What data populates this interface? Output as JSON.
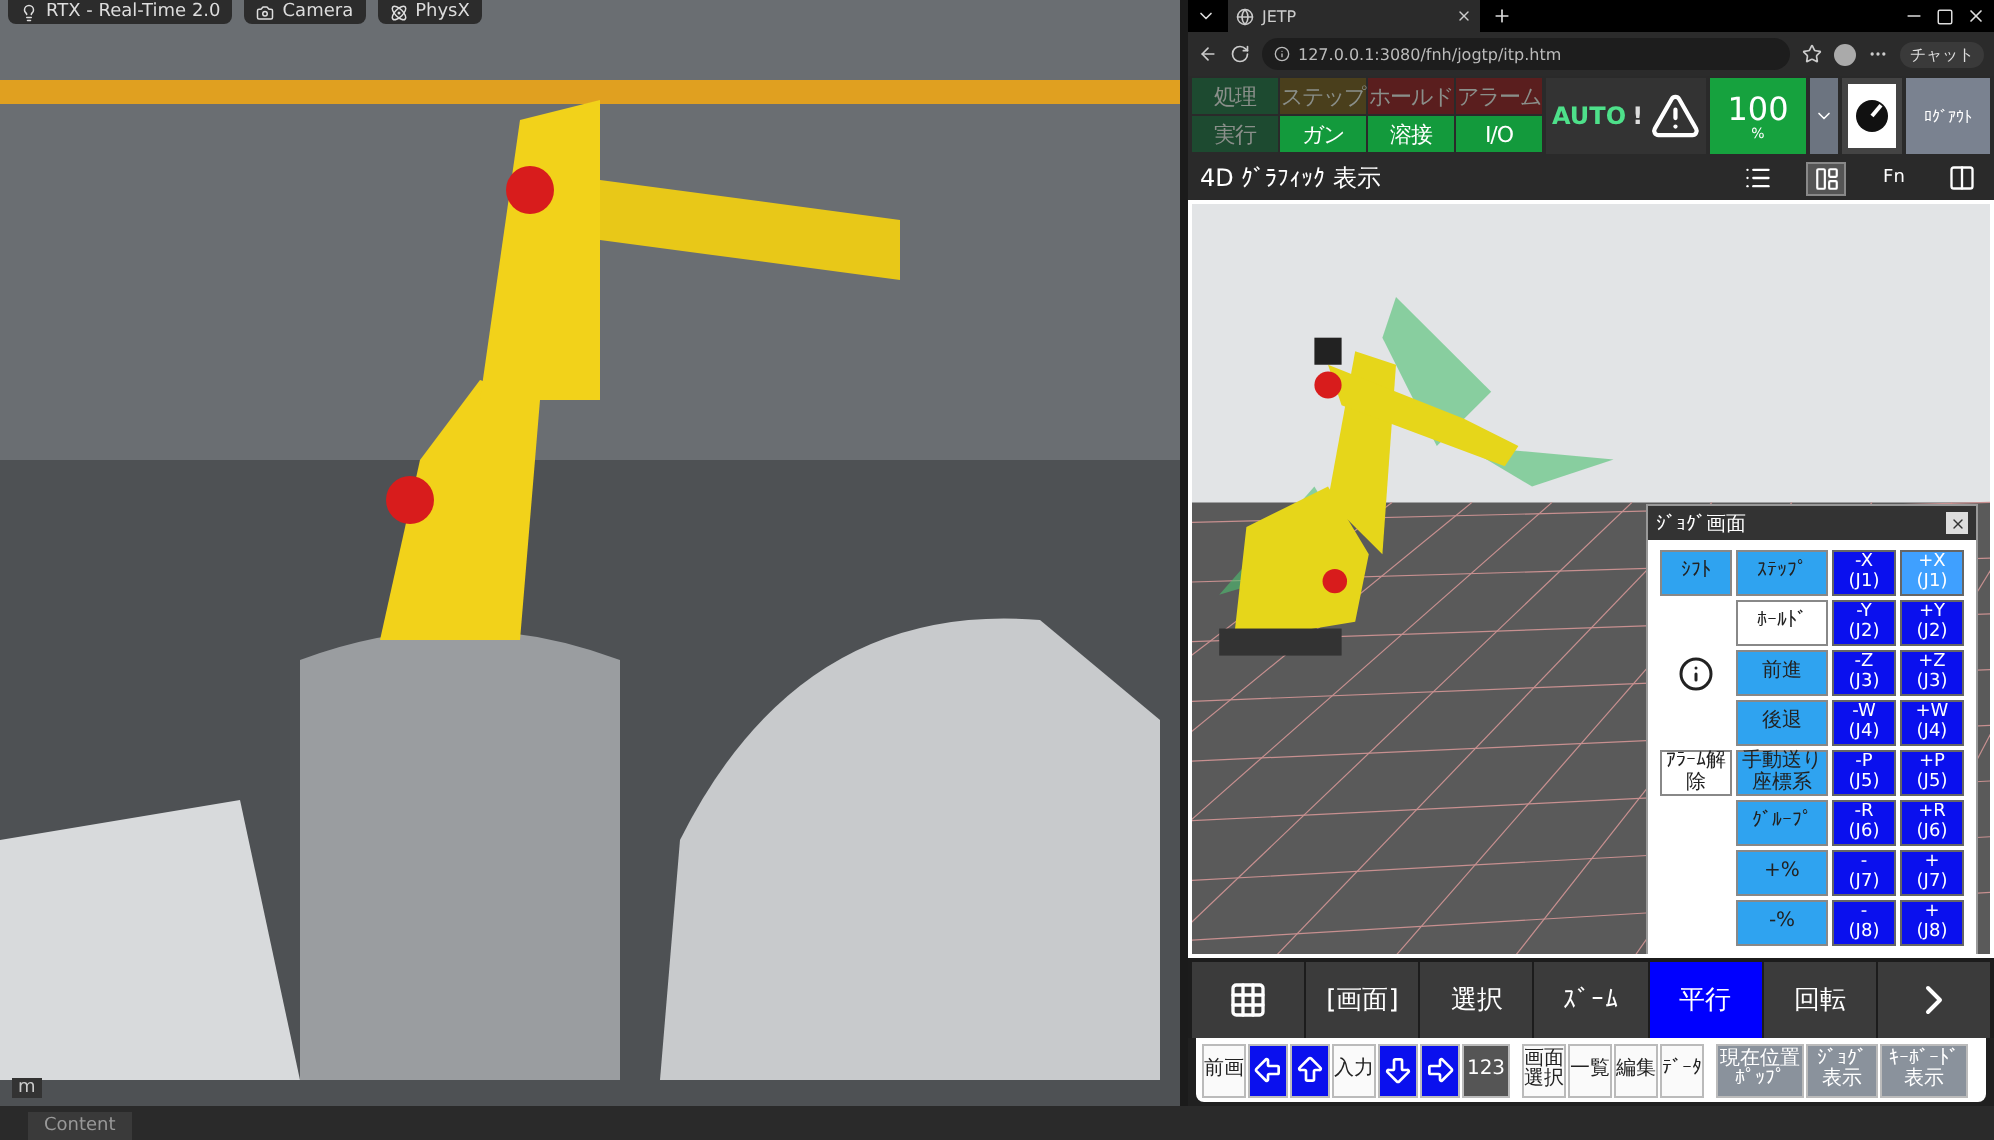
{
  "scene": {
    "toolbar": [
      {
        "kind": "render",
        "label": "RTX - Real-Time 2.0"
      },
      {
        "kind": "camera",
        "label": "Camera"
      },
      {
        "kind": "physics",
        "label": "PhysX"
      }
    ],
    "unit": "m"
  },
  "bottom_tabs": [
    {
      "label": "Content",
      "selected": true
    }
  ],
  "browser": {
    "tab_title": "JETP",
    "url": "127.0.0.1:3080/fnh/jogtp/itp.htm",
    "chat_label": "チャット"
  },
  "status": [
    {
      "label": "処理",
      "on": false,
      "color": "#1d4a30"
    },
    {
      "label": "ステップ",
      "on": false,
      "color": "#4a3f1c"
    },
    {
      "label": "ホールド",
      "on": false,
      "color": "#5a1e1e"
    },
    {
      "label": "アラーム",
      "on": false,
      "color": "#5a1e1e"
    },
    {
      "label": "実行",
      "on": false,
      "color": "#1d4a30"
    },
    {
      "label": "ガン",
      "on": true,
      "color": "#139a3c"
    },
    {
      "label": "溶接",
      "on": true,
      "color": "#139a3c"
    },
    {
      "label": "I/O",
      "on": true,
      "color": "#139a3c"
    }
  ],
  "mode": "AUTO",
  "alert_mark": "!",
  "override": {
    "value": "100",
    "unit": "%"
  },
  "logout": "ﾛｸﾞｱｳﾄ",
  "screen_title": "4D ｸﾞﾗﾌｨｯｸ 表示",
  "view_tools": [
    {
      "kind": "list",
      "selected": false
    },
    {
      "kind": "split",
      "selected": true
    },
    {
      "kind": "fn",
      "label": "Fn",
      "selected": false
    },
    {
      "kind": "layout",
      "selected": false
    }
  ],
  "jog_panel": {
    "title": "ｼﾞｮｸﾞ画面",
    "left": [
      {
        "kind": "key",
        "label": "ｼﾌﾄ",
        "lit": true
      },
      {
        "kind": "info"
      },
      {
        "kind": "key",
        "label": "ｱﾗｰﾑ解除",
        "lit": false
      }
    ],
    "middle": [
      {
        "label": "ｽﾃｯﾌﾟ",
        "lit": true
      },
      {
        "label": "ﾎｰﾙﾄﾞ",
        "lit": false
      },
      {
        "label": "前進",
        "lit": true
      },
      {
        "label": "後退",
        "lit": true
      },
      {
        "label": "手動送り座標系",
        "lit": true
      },
      {
        "label": "ｸﾞﾙｰﾌﾟ",
        "lit": true
      },
      {
        "label": "+%",
        "lit": true
      },
      {
        "label": "-%",
        "lit": true
      }
    ],
    "axes": [
      {
        "minus": {
          "label": "-X",
          "axis": "(J1)",
          "highlighted": false
        },
        "plus": {
          "label": "+X",
          "axis": "(J1)",
          "highlighted": true
        }
      },
      {
        "minus": {
          "label": "-Y",
          "axis": "(J2)",
          "highlighted": false
        },
        "plus": {
          "label": "+Y",
          "axis": "(J2)",
          "highlighted": false
        }
      },
      {
        "minus": {
          "label": "-Z",
          "axis": "(J3)",
          "highlighted": false
        },
        "plus": {
          "label": "+Z",
          "axis": "(J3)",
          "highlighted": false
        }
      },
      {
        "minus": {
          "label": "-W",
          "axis": "(J4)",
          "highlighted": false
        },
        "plus": {
          "label": "+W",
          "axis": "(J4)",
          "highlighted": false
        }
      },
      {
        "minus": {
          "label": "-P",
          "axis": "(J5)",
          "highlighted": false
        },
        "plus": {
          "label": "+P",
          "axis": "(J5)",
          "highlighted": false
        }
      },
      {
        "minus": {
          "label": "-R",
          "axis": "(J6)",
          "highlighted": false
        },
        "plus": {
          "label": "+R",
          "axis": "(J6)",
          "highlighted": false
        }
      },
      {
        "minus": {
          "label": "-",
          "axis": "(J7)",
          "highlighted": false
        },
        "plus": {
          "label": "+",
          "axis": "(J7)",
          "highlighted": false
        }
      },
      {
        "minus": {
          "label": "-",
          "axis": "(J8)",
          "highlighted": false
        },
        "plus": {
          "label": "+",
          "axis": "(J8)",
          "highlighted": false
        }
      }
    ]
  },
  "menu": [
    {
      "kind": "grid",
      "selected": false
    },
    {
      "kind": "text",
      "label": "[画面]",
      "selected": false
    },
    {
      "kind": "text",
      "label": "選択",
      "selected": false
    },
    {
      "kind": "text",
      "label": "ｽﾞｰﾑ",
      "selected": false
    },
    {
      "kind": "text",
      "label": "平行",
      "selected": true
    },
    {
      "kind": "text",
      "label": "回転",
      "selected": false
    },
    {
      "kind": "next",
      "selected": false
    }
  ],
  "keys": [
    {
      "kind": "text",
      "label": "前画"
    },
    {
      "kind": "left"
    },
    {
      "kind": "up"
    },
    {
      "kind": "enter",
      "label": "入力"
    },
    {
      "kind": "down"
    },
    {
      "kind": "right"
    },
    {
      "kind": "keypad",
      "label": "123"
    },
    {
      "kind": "text",
      "label": "画面選択"
    },
    {
      "kind": "text",
      "label": "一覧"
    },
    {
      "kind": "text",
      "label": "編集"
    },
    {
      "kind": "text",
      "label": "ﾃﾞｰﾀ"
    },
    {
      "kind": "grey",
      "label": "現在位置ﾎﾟｯﾌﾟ"
    },
    {
      "kind": "grey",
      "label": "ｼﾞｮｸﾞ表示"
    },
    {
      "kind": "grey",
      "label": "ｷｰﾎﾞｰﾄﾞ表示"
    }
  ]
}
